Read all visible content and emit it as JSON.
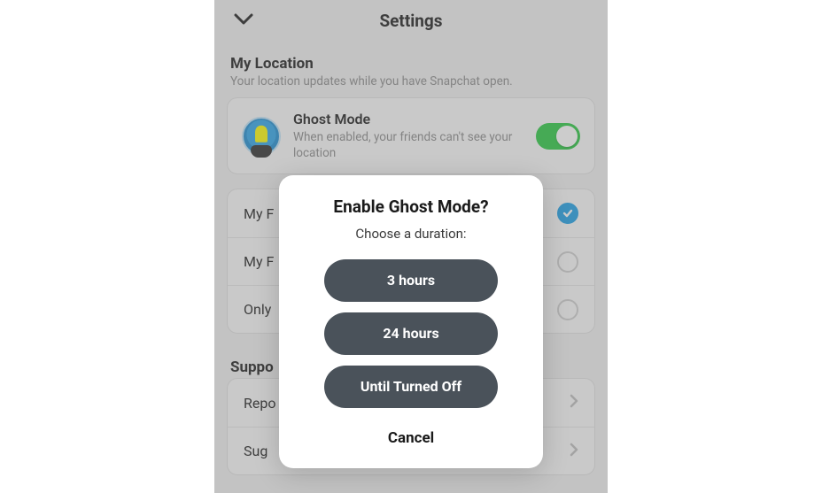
{
  "header": {
    "title": "Settings"
  },
  "location_section": {
    "heading": "My Location",
    "sub": "Your location updates while you have Snapchat open."
  },
  "ghost_card": {
    "title": "Ghost Mode",
    "sub": "When enabled, your friends can't see your location"
  },
  "share_options": {
    "row1": "My F",
    "row2": "My F",
    "row3": "Only"
  },
  "support_section": {
    "heading": "Suppo",
    "row1": "Repo",
    "row2": "Sug"
  },
  "modal": {
    "title": "Enable Ghost Mode?",
    "sub": "Choose a duration:",
    "option1": "3 hours",
    "option2": "24 hours",
    "option3": "Until Turned Off",
    "cancel": "Cancel"
  }
}
